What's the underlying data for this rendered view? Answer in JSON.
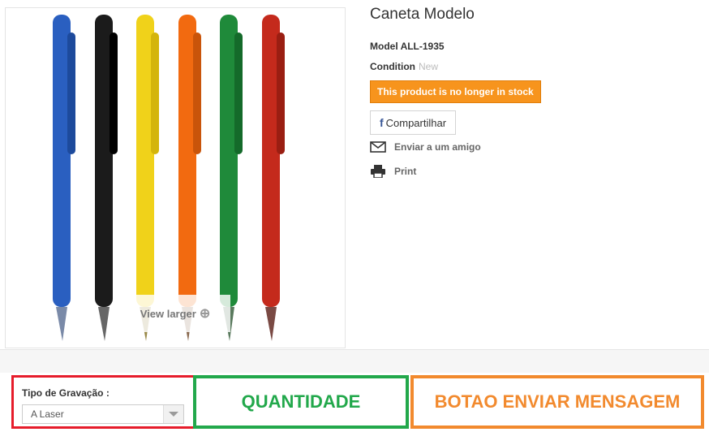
{
  "product": {
    "title": "Caneta Modelo",
    "model_label": "Model",
    "model_value": "ALL-1935",
    "condition_label": "Condition",
    "condition_value": "New",
    "stock_notice": "This product is no longer in stock",
    "image": {
      "view_larger": "View larger",
      "pen_colors": [
        "#2a5fc0",
        "#1b1b1b",
        "#f0d21a",
        "#f26a10",
        "#1f8a3a",
        "#c42a1c"
      ]
    }
  },
  "actions": {
    "share_icon": "f",
    "share_label": "Compartilhar",
    "send_friend_label": "Enviar a um amigo",
    "print_label": "Print"
  },
  "options": {
    "engraving_label": "Tipo de Gravação :",
    "engraving_selected": "A Laser"
  },
  "annotations": {
    "quantity": "QUANTIDADE",
    "send_button": "BOTAO ENVIAR MENSAGEM"
  },
  "colors": {
    "stock_badge": "#f7941d",
    "red_box": "#e61c2b",
    "green_box": "#22a84b",
    "orange_box": "#f28a2e"
  }
}
